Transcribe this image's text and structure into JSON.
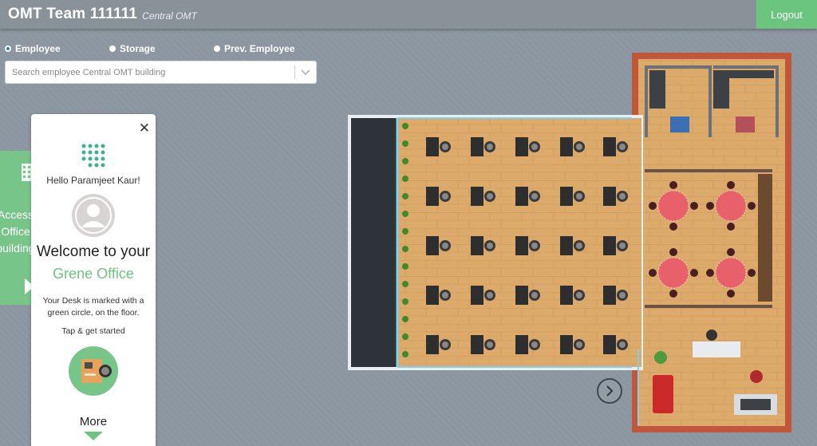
{
  "header": {
    "title": "OMT Team 111111",
    "subtitle": "Central OMT",
    "logout_label": "Logout"
  },
  "search_mode": {
    "options": [
      {
        "label": "Employee",
        "selected": true
      },
      {
        "label": "Storage",
        "selected": false
      },
      {
        "label": "Prev. Employee",
        "selected": false
      }
    ]
  },
  "search": {
    "placeholder": "Search employee Central OMT building"
  },
  "side_panel": {
    "text_lines": [
      "Access",
      "Office",
      "building"
    ]
  },
  "welcome_card": {
    "greeting": "Hello Paramjeet Kaur!",
    "heading": "Welcome to your",
    "brand": "Grene Office",
    "description": "Your Desk is marked with a green circle, on the floor.",
    "cta": "Tap & get started",
    "more_label": "More"
  },
  "colors": {
    "accent": "#6cc57e",
    "header": "#8a9299",
    "background": "#8c96a0",
    "floor_wood": "#d9a766",
    "wall_brick": "#c0573a",
    "table_red": "#e8606a"
  }
}
